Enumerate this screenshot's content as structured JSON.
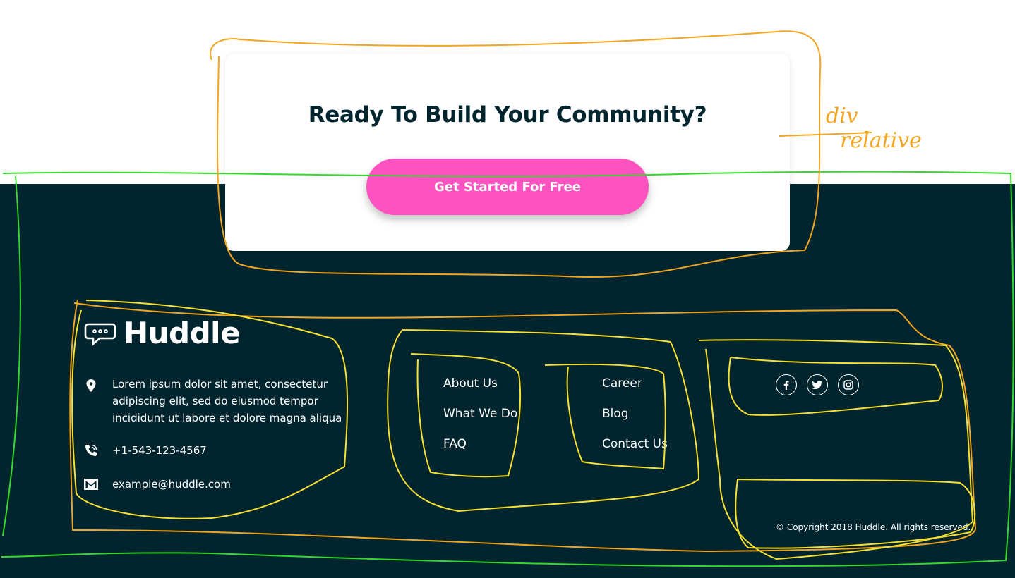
{
  "cta": {
    "title": "Ready To Build Your Community?",
    "button_label": "Get Started For Free"
  },
  "brand": {
    "name": "Huddle",
    "icon": "chat-bubble-icon"
  },
  "contact": {
    "address": "Lorem ipsum dolor sit amet, consectetur adipiscing elit, sed do eiusmod tempor incididunt ut labore et dolore magna aliqua",
    "phone": "+1-543-123-4567",
    "email": "example@huddle.com"
  },
  "links": {
    "col1": [
      "About Us",
      "What We Do",
      "FAQ"
    ],
    "col2": [
      "Career",
      "Blog",
      "Contact Us"
    ]
  },
  "social": [
    {
      "icon": "facebook-icon"
    },
    {
      "icon": "twitter-icon"
    },
    {
      "icon": "instagram-icon"
    }
  ],
  "copyright": "© Copyright 2018 Huddle. All rights reserved.",
  "annotation": {
    "line1": "div",
    "line2": "relative"
  },
  "colors": {
    "footer_bg": "#00252e",
    "cta_button": "#ff52c1",
    "sketch_orange": "#f2a521",
    "sketch_yellow": "#f7e032",
    "sketch_green": "#35d92c"
  }
}
